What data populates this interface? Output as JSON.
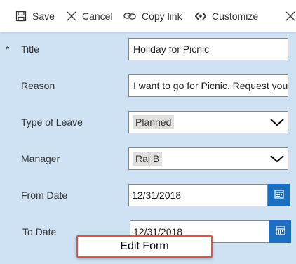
{
  "toolbar": {
    "save_label": "Save",
    "cancel_label": "Cancel",
    "copy_link_label": "Copy link",
    "customize_label": "Customize",
    "close_icon": "close-icon"
  },
  "form": {
    "title": {
      "label": "Title",
      "required_marker": "*",
      "value": "Holiday for Picnic"
    },
    "reason": {
      "label": "Reason",
      "value": "I want to go for Picnic. Request you"
    },
    "type_of_leave": {
      "label": "Type of Leave",
      "value": "Planned"
    },
    "manager": {
      "label": "Manager",
      "value": "Raj B"
    },
    "from_date": {
      "label": "From Date",
      "value": "12/31/2018"
    },
    "to_date": {
      "label": "To Date",
      "value": "12/31/2018"
    }
  },
  "callout": {
    "text": "Edit Form"
  },
  "colors": {
    "page_background": "#cfe2f4",
    "accent": "#1b6fc0",
    "callout_border": "#e2504c"
  }
}
